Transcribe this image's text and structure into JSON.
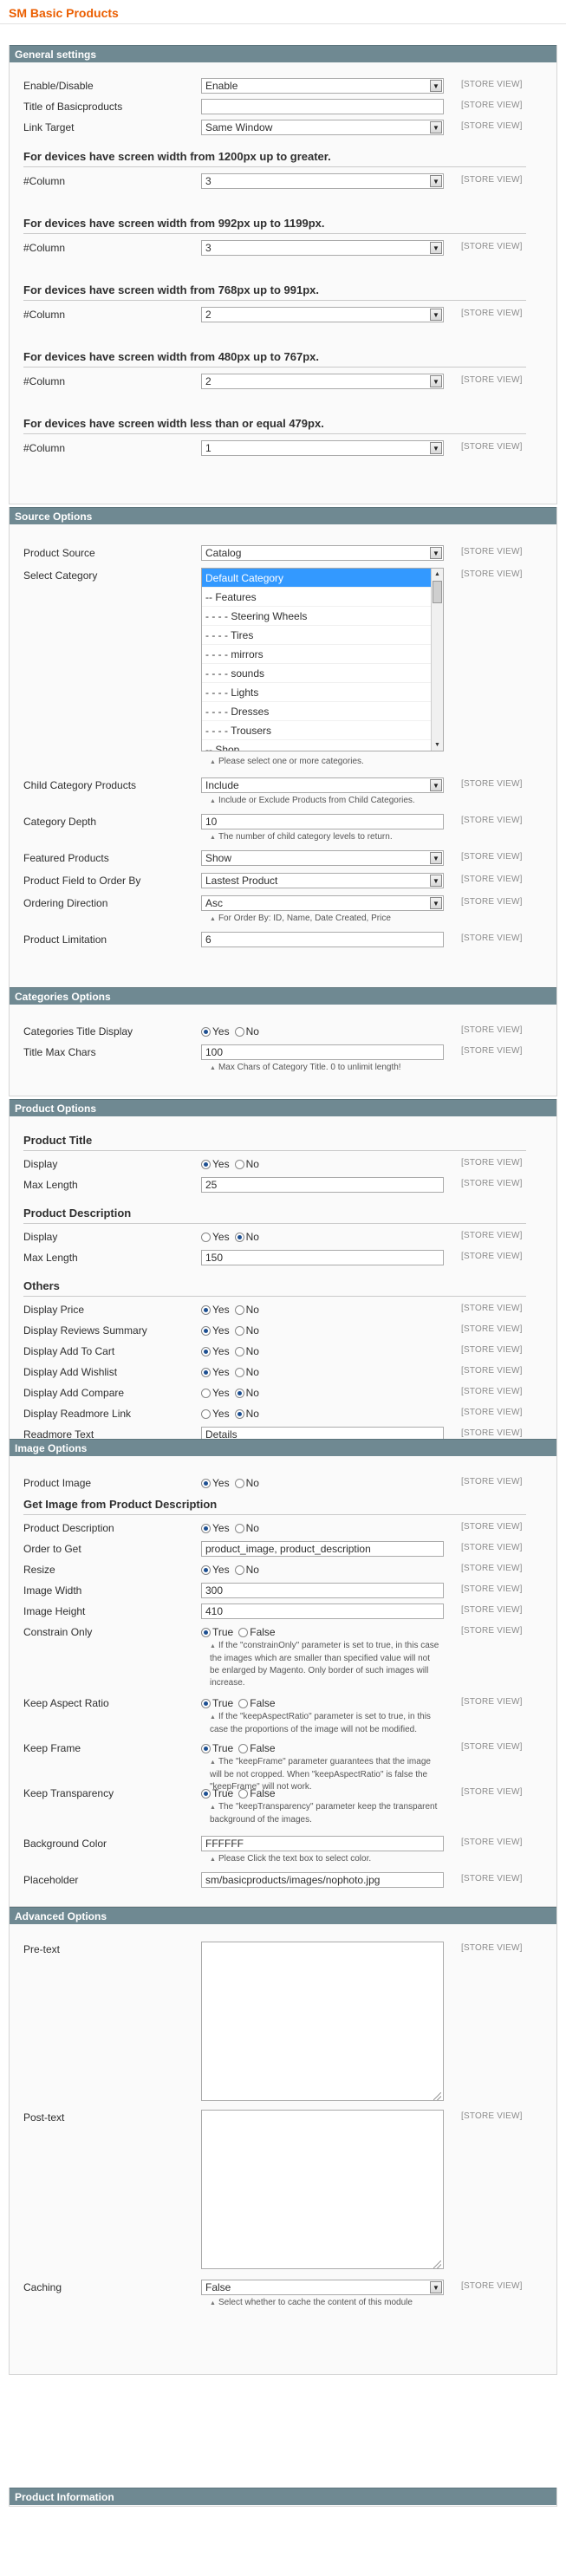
{
  "page": {
    "title": "SM Basic Products"
  },
  "store_view": "[STORE VIEW]",
  "general": {
    "header": "General settings",
    "enable": {
      "label": "Enable/Disable",
      "value": "Enable"
    },
    "title": {
      "label": "Title of Basicproducts",
      "value": ""
    },
    "link_target": {
      "label": "Link Target",
      "value": "Same Window"
    },
    "devices": [
      {
        "heading": "For devices have screen width from 1200px up to greater.",
        "label": "#Column",
        "value": "3"
      },
      {
        "heading": "For devices have screen width from 992px up to 1199px.",
        "label": "#Column",
        "value": "3"
      },
      {
        "heading": "For devices have screen width from 768px up to 991px.",
        "label": "#Column",
        "value": "2"
      },
      {
        "heading": "For devices have screen width from 480px up to 767px.",
        "label": "#Column",
        "value": "2"
      },
      {
        "heading": "For devices have screen width less than or equal 479px.",
        "label": "#Column",
        "value": "1"
      }
    ]
  },
  "source": {
    "header": "Source Options",
    "product_source": {
      "label": "Product Source",
      "value": "Catalog"
    },
    "select_category": {
      "label": "Select Category",
      "options": [
        "Default Category",
        "-- Features",
        "- - - - Steering Wheels",
        "- - - - Tires",
        "- - - - mirrors",
        "- - - - sounds",
        "- - - - Lights",
        "- - - - Dresses",
        "- - - - Trousers",
        "-- Shop"
      ],
      "selected": 0,
      "note": "Please select one or more categories."
    },
    "child_category": {
      "label": "Child Category Products",
      "value": "Include",
      "note": "Include or Exclude Products from Child Categories."
    },
    "depth": {
      "label": "Category Depth",
      "value": "10",
      "note": "The number of child category levels to return."
    },
    "featured": {
      "label": "Featured Products",
      "value": "Show"
    },
    "order_by": {
      "label": "Product Field to Order By",
      "value": "Lastest Product"
    },
    "order_dir": {
      "label": "Ordering Direction",
      "value": "Asc",
      "note": "For Order By: ID, Name, Date Created, Price"
    },
    "limit": {
      "label": "Product Limitation",
      "value": "6"
    }
  },
  "categories": {
    "header": "Categories Options",
    "title_display": {
      "label": "Categories Title Display",
      "yes": "Yes",
      "no": "No",
      "value": "yes"
    },
    "max_chars": {
      "label": "Title Max Chars",
      "value": "100",
      "note": "Max Chars of Category Title. 0 to unlimit length!"
    }
  },
  "product": {
    "header": "Product Options",
    "title_heading": "Product Title",
    "title_display": {
      "label": "Display",
      "yes": "Yes",
      "no": "No",
      "value": "yes"
    },
    "title_max": {
      "label": "Max Length",
      "value": "25"
    },
    "desc_heading": "Product Description",
    "desc_display": {
      "label": "Display",
      "yes": "Yes",
      "no": "No",
      "value": "no"
    },
    "desc_max": {
      "label": "Max Length",
      "value": "150"
    },
    "others_heading": "Others",
    "price": {
      "label": "Display Price",
      "yes": "Yes",
      "no": "No",
      "value": "yes"
    },
    "reviews": {
      "label": "Display Reviews Summary",
      "yes": "Yes",
      "no": "No",
      "value": "yes"
    },
    "cart": {
      "label": "Display Add To Cart",
      "yes": "Yes",
      "no": "No",
      "value": "yes"
    },
    "wishlist": {
      "label": "Display Add Wishlist",
      "yes": "Yes",
      "no": "No",
      "value": "yes"
    },
    "compare": {
      "label": "Display Add Compare",
      "yes": "Yes",
      "no": "No",
      "value": "no"
    },
    "readmore": {
      "label": "Display Readmore Link",
      "yes": "Yes",
      "no": "No",
      "value": "no"
    },
    "readmore_text": {
      "label": "Readmore Text",
      "value": "Details"
    }
  },
  "image": {
    "header": "Image Options",
    "product_image": {
      "label": "Product Image",
      "yes": "Yes",
      "no": "No",
      "value": "yes"
    },
    "from_desc_heading": "Get Image from Product Description",
    "product_desc": {
      "label": "Product Description",
      "yes": "Yes",
      "no": "No",
      "value": "yes"
    },
    "order": {
      "label": "Order to Get",
      "value": "product_image, product_description"
    },
    "resize": {
      "label": "Resize",
      "yes": "Yes",
      "no": "No",
      "value": "yes"
    },
    "width": {
      "label": "Image Width",
      "value": "300"
    },
    "height": {
      "label": "Image Height",
      "value": "410"
    },
    "constrain": {
      "label": "Constrain Only",
      "yes": "True",
      "no": "False",
      "value": "yes",
      "note": "If the \"constrainOnly\" parameter is set to true, in this case the images which are smaller than specified value will not be enlarged by Magento. Only border of such images will increase."
    },
    "aspect": {
      "label": "Keep Aspect Ratio",
      "yes": "True",
      "no": "False",
      "value": "yes",
      "note": "If the \"keepAspectRatio\" parameter is set to true, in this case the proportions of the image will not be modified."
    },
    "frame": {
      "label": "Keep Frame",
      "yes": "True",
      "no": "False",
      "value": "yes",
      "note": "The \"keepFrame\" parameter guarantees that the image will be not cropped. When \"keepAspectRatio\" is false the \"keepFrame\" will not work."
    },
    "transparency": {
      "label": "Keep Transparency",
      "yes": "True",
      "no": "False",
      "value": "yes",
      "note": "The \"keepTransparency\" parameter keep the transparent background of the images."
    },
    "bg": {
      "label": "Background Color",
      "value": "FFFFFF",
      "note": "Please Click the text box to select color."
    },
    "placeholder": {
      "label": "Placeholder",
      "value": "sm/basicproducts/images/nophoto.jpg"
    }
  },
  "advanced": {
    "header": "Advanced Options",
    "pretext": {
      "label": "Pre-text",
      "value": ""
    },
    "posttext": {
      "label": "Post-text",
      "value": ""
    },
    "caching": {
      "label": "Caching",
      "value": "False",
      "note": "Select whether to cache the content of this module"
    }
  },
  "info": {
    "header": "Product Information"
  }
}
